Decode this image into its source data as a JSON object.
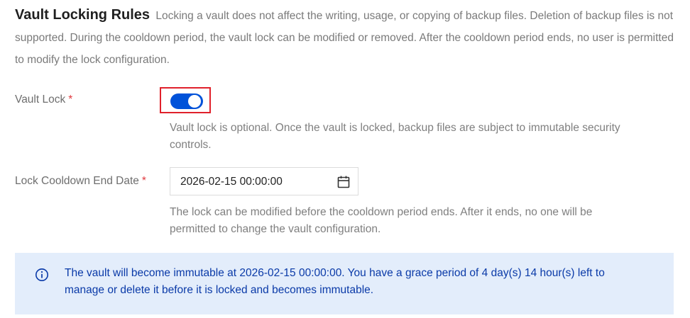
{
  "section": {
    "title": "Vault Locking Rules",
    "description": "Locking a vault does not affect the writing, usage, or copying of backup files. Deletion of backup files is not supported. During the cooldown period, the vault lock can be modified or removed. After the cooldown period ends, no user is permitted to modify the lock configuration."
  },
  "vault_lock": {
    "label": "Vault Lock",
    "required_mark": "*",
    "enabled": true,
    "help": "Vault lock is optional. Once the vault is locked, backup files are subject to immutable security controls."
  },
  "cooldown": {
    "label": "Lock Cooldown End Date",
    "required_mark": "*",
    "value": "2026-02-15 00:00:00",
    "icon": "calendar-icon",
    "help": "The lock can be modified before the cooldown period ends. After it ends, no one will be permitted to change the vault configuration."
  },
  "notice": {
    "icon": "info-icon",
    "text": "The vault will become immutable at 2026-02-15 00:00:00. You have a grace period of 4 day(s) 14 hour(s) left to manage or delete it before it is locked and becomes immutable."
  },
  "colors": {
    "accent": "#0052d9",
    "required": "#e0393e",
    "highlight_border": "#e0212b",
    "notice_bg": "#e3edfb",
    "notice_text": "#0a3aa8"
  }
}
